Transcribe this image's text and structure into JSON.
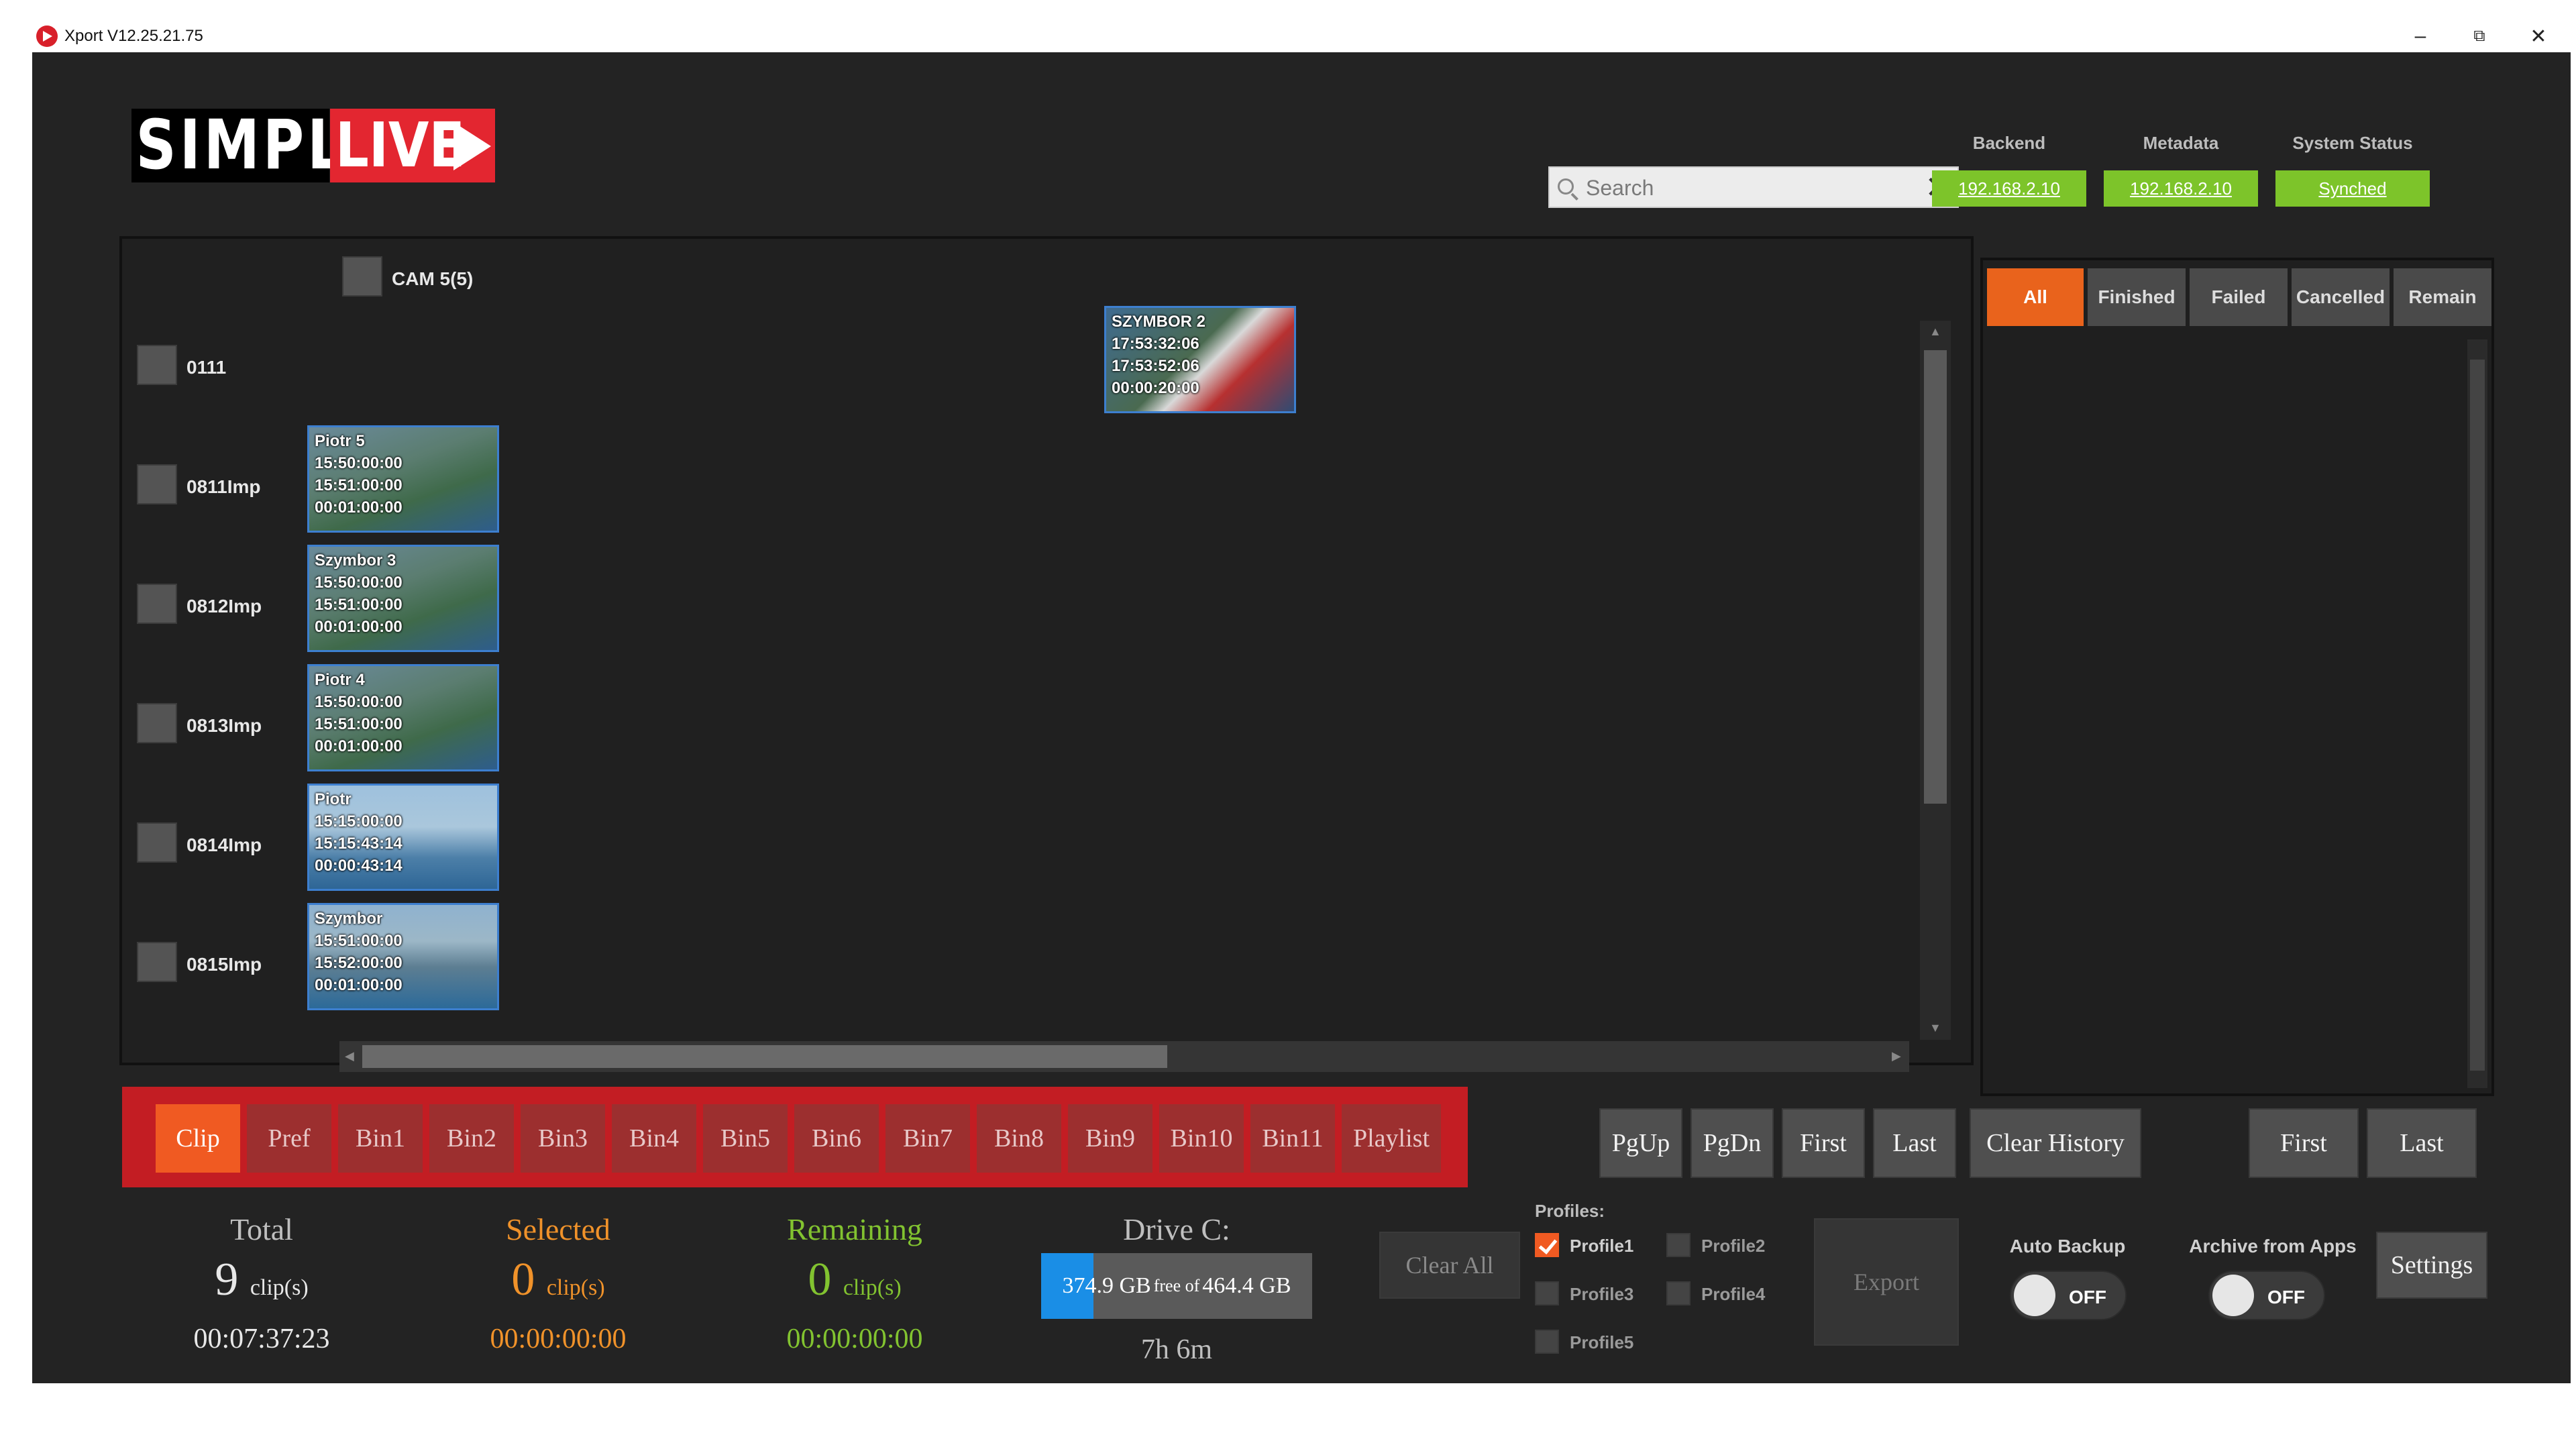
{
  "window": {
    "title": "Xport V12.25.21.75",
    "minimize": "–",
    "maximize": "⧉",
    "close": "✕"
  },
  "logo": {
    "text_simply": "SIMPLY",
    "text_live": "LIVE"
  },
  "search": {
    "placeholder": "Search",
    "value": ""
  },
  "status": {
    "backend_label": "Backend",
    "backend_value": "192.168.2.10",
    "metadata_label": "Metadata",
    "metadata_value": "192.168.2.10",
    "system_label": "System Status",
    "system_value": "Synched"
  },
  "clips": {
    "column_header": "CAM 5(5)",
    "rows": [
      {
        "label": "0111",
        "clip": {
          "name": "SZYMBOR 2",
          "in": "17:53:32:06",
          "out": "17:53:52:06",
          "duration": "00:00:20:00"
        }
      },
      {
        "label": "0811Imp",
        "clip": {
          "name": "Piotr 5",
          "in": "15:50:00:00",
          "out": "15:51:00:00",
          "duration": "00:01:00:00"
        }
      },
      {
        "label": "0812Imp",
        "clip": {
          "name": "Szymbor 3",
          "in": "15:50:00:00",
          "out": "15:51:00:00",
          "duration": "00:01:00:00"
        }
      },
      {
        "label": "0813Imp",
        "clip": {
          "name": "Piotr 4",
          "in": "15:50:00:00",
          "out": "15:51:00:00",
          "duration": "00:01:00:00"
        }
      },
      {
        "label": "0814Imp",
        "clip": {
          "name": "Piotr",
          "in": "15:15:00:00",
          "out": "15:15:43:14",
          "duration": "00:00:43:14"
        }
      },
      {
        "label": "0815Imp",
        "clip": {
          "name": "Szymbor",
          "in": "15:51:00:00",
          "out": "15:52:00:00",
          "duration": "00:01:00:00"
        }
      }
    ]
  },
  "filters": {
    "tabs": [
      "All",
      "Finished",
      "Failed",
      "Cancelled",
      "Remain"
    ],
    "active": "All"
  },
  "bins": {
    "items": [
      "Clip",
      "Pref",
      "Bin1",
      "Bin2",
      "Bin3",
      "Bin4",
      "Bin5",
      "Bin6",
      "Bin7",
      "Bin8",
      "Bin9",
      "Bin10",
      "Bin11",
      "Playlist"
    ],
    "active": "Clip"
  },
  "nav": {
    "pgup": "PgUp",
    "pgdn": "PgDn",
    "first": "First",
    "last": "Last",
    "clear_history": "Clear History",
    "first2": "First",
    "last2": "Last"
  },
  "stats": {
    "total_label": "Total",
    "total_count": "9",
    "total_unit": "clip(s)",
    "total_time": "00:07:37:23",
    "selected_label": "Selected",
    "selected_count": "0",
    "selected_unit": "clip(s)",
    "selected_time": "00:00:00:00",
    "remaining_label": "Remaining",
    "remaining_count": "0",
    "remaining_unit": "clip(s)",
    "remaining_time": "00:00:00:00"
  },
  "drive": {
    "label": "Drive C:",
    "free": "374.9 GB",
    "free_of": "free of",
    "total": "464.4 GB",
    "time_left": "7h 6m",
    "used_fraction": 0.193
  },
  "clear_all": "Clear All",
  "profiles": {
    "label": "Profiles:",
    "items": [
      {
        "name": "Profile1",
        "checked": true
      },
      {
        "name": "Profile2",
        "checked": false
      },
      {
        "name": "Profile3",
        "checked": false
      },
      {
        "name": "Profile4",
        "checked": false
      },
      {
        "name": "Profile5",
        "checked": false
      }
    ]
  },
  "export": "Export",
  "auto_backup": {
    "label": "Auto Backup",
    "state": "OFF"
  },
  "archive": {
    "label": "Archive from Apps",
    "state": "OFF"
  },
  "settings": "Settings",
  "colors": {
    "accent": "#f05a22",
    "status_green": "#7dc42a",
    "bin_bar": "#c31d23",
    "drive_blue": "#1a8ee6"
  }
}
